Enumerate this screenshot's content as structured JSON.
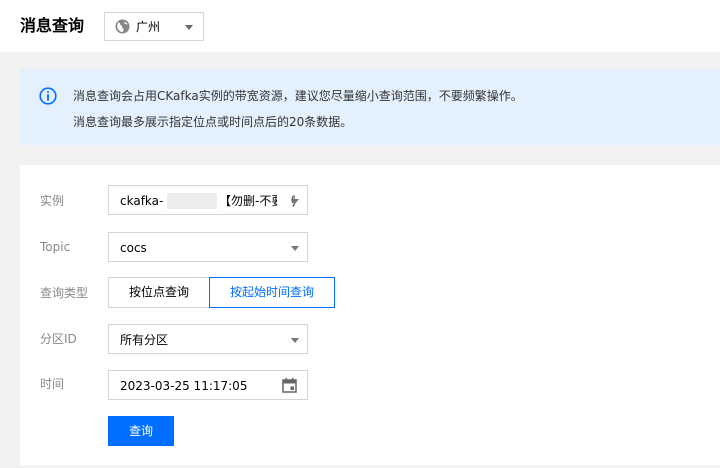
{
  "header": {
    "title": "消息查询",
    "region": {
      "value": "广州",
      "icon": "globe-icon"
    }
  },
  "notice": {
    "icon": "info-icon",
    "line1": "消息查询会占用CKafka实例的带宽资源，建议您尽量缩小查询范围，不要频繁操作。",
    "line2": "消息查询最多展示指定位点或时间点后的20条数据。",
    "accent": "#006eff",
    "background": "#e5f0ff"
  },
  "form": {
    "instance": {
      "label": "实例",
      "value_prefix": "ckafka-",
      "value_suffix": "【勿删-不要删"
    },
    "topic": {
      "label": "Topic",
      "value": "cocs"
    },
    "query_type": {
      "label": "查询类型",
      "options": [
        "按位点查询",
        "按起始时间查询"
      ],
      "selected": "按起始时间查询"
    },
    "partition": {
      "label": "分区ID",
      "value": "所有分区"
    },
    "time": {
      "label": "时间",
      "value": "2023-03-25 11:17:05",
      "icon": "calendar-icon"
    },
    "submit_label": "查询"
  },
  "colors": {
    "primary": "#006eff",
    "border": "#cfd5de",
    "label": "#888888"
  }
}
